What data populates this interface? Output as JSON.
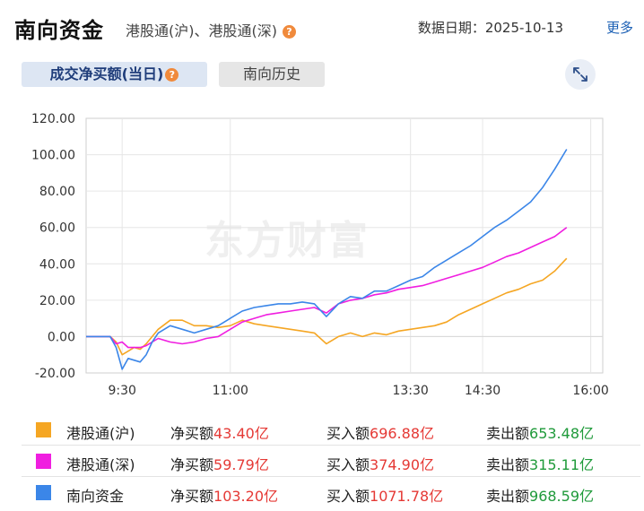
{
  "header": {
    "title": "南向资金",
    "subtitle": "港股通(沪)、港股通(深)",
    "help_icon": "?",
    "date_label": "数据日期：2025-10-13",
    "more_link": "更多"
  },
  "tabs": [
    {
      "label": "成交净买额(当日)",
      "active": true
    },
    {
      "label": "南向历史",
      "active": false
    }
  ],
  "watermark": "东方财富",
  "colors": {
    "hu": "#f5a623",
    "shen": "#f01ee0",
    "total": "#3b86e8"
  },
  "chart_data": {
    "type": "line",
    "title": "",
    "xlabel": "",
    "ylabel": "",
    "ylim": [
      -20,
      120
    ],
    "yticks": [
      "120.00",
      "100.00",
      "80.00",
      "60.00",
      "40.00",
      "20.00",
      "0.00",
      "-20.00"
    ],
    "xticks": [
      "9:30",
      "11:00",
      "13:30",
      "14:30",
      "16:00"
    ],
    "x_time_range": [
      "9:00",
      "16:10"
    ],
    "grid": true,
    "legend": "bottom-table",
    "series": [
      {
        "name": "港股通(沪)",
        "color": "#f5a623",
        "x": [
          "9:00",
          "9:20",
          "9:25",
          "9:30",
          "9:35",
          "9:40",
          "9:45",
          "9:50",
          "9:55",
          "10:00",
          "10:10",
          "10:20",
          "10:30",
          "10:40",
          "10:50",
          "11:00",
          "11:10",
          "11:20",
          "11:30",
          "11:40",
          "11:50",
          "12:00",
          "12:10",
          "12:20",
          "12:30",
          "12:40",
          "12:50",
          "13:00",
          "13:10",
          "13:20",
          "13:30",
          "13:40",
          "13:50",
          "14:00",
          "14:10",
          "14:20",
          "14:30",
          "14:40",
          "14:50",
          "15:00",
          "15:10",
          "15:20",
          "15:30",
          "15:40"
        ],
        "values": [
          0,
          0,
          -3,
          -10,
          -8,
          -6,
          -7,
          -4,
          0,
          4,
          9,
          9,
          6,
          6,
          5,
          6,
          9,
          7,
          6,
          5,
          4,
          3,
          2,
          -4,
          0,
          2,
          0,
          2,
          1,
          3,
          4,
          5,
          6,
          8,
          12,
          15,
          18,
          21,
          24,
          26,
          29,
          31,
          36,
          43
        ]
      },
      {
        "name": "港股通(深)",
        "color": "#f01ee0",
        "x": [
          "9:00",
          "9:20",
          "9:25",
          "9:30",
          "9:35",
          "9:40",
          "9:45",
          "9:50",
          "9:55",
          "10:00",
          "10:10",
          "10:20",
          "10:30",
          "10:40",
          "10:50",
          "11:00",
          "11:10",
          "11:20",
          "11:30",
          "11:40",
          "11:50",
          "12:00",
          "12:10",
          "12:20",
          "12:30",
          "12:40",
          "12:50",
          "13:00",
          "13:10",
          "13:20",
          "13:30",
          "13:40",
          "13:50",
          "14:00",
          "14:10",
          "14:20",
          "14:30",
          "14:40",
          "14:50",
          "15:00",
          "15:10",
          "15:20",
          "15:30",
          "15:40"
        ],
        "values": [
          0,
          0,
          -4,
          -3,
          -6,
          -6,
          -6,
          -5,
          -3,
          -1,
          -3,
          -4,
          -3,
          -1,
          0,
          4,
          8,
          10,
          12,
          13,
          14,
          15,
          16,
          13,
          18,
          20,
          21,
          23,
          24,
          26,
          27,
          28,
          30,
          32,
          34,
          36,
          38,
          41,
          44,
          46,
          49,
          52,
          55,
          60
        ]
      },
      {
        "name": "南向资金",
        "color": "#3b86e8",
        "x": [
          "9:00",
          "9:20",
          "9:25",
          "9:30",
          "9:35",
          "9:40",
          "9:45",
          "9:50",
          "9:55",
          "10:00",
          "10:10",
          "10:20",
          "10:30",
          "10:40",
          "10:50",
          "11:00",
          "11:10",
          "11:20",
          "11:30",
          "11:40",
          "11:50",
          "12:00",
          "12:10",
          "12:20",
          "12:30",
          "12:40",
          "12:50",
          "13:00",
          "13:10",
          "13:20",
          "13:30",
          "13:40",
          "13:50",
          "14:00",
          "14:10",
          "14:20",
          "14:30",
          "14:40",
          "14:50",
          "15:00",
          "15:10",
          "15:20",
          "15:30",
          "15:40"
        ],
        "values": [
          0,
          0,
          -6,
          -18,
          -12,
          -13,
          -14,
          -10,
          -3,
          2,
          6,
          4,
          2,
          4,
          6,
          10,
          14,
          16,
          17,
          18,
          18,
          19,
          18,
          11,
          18,
          22,
          21,
          25,
          25,
          28,
          31,
          33,
          38,
          42,
          46,
          50,
          55,
          60,
          64,
          69,
          74,
          82,
          92,
          103
        ]
      }
    ]
  },
  "legend": [
    {
      "swatch_color": "#f5a623",
      "name": "港股通(沪)",
      "net_label": "净买额",
      "net_value": "43.40亿",
      "buy_label": "买入额",
      "buy_value": "696.88亿",
      "sell_label": "卖出额",
      "sell_value": "653.48亿"
    },
    {
      "swatch_color": "#f01ee0",
      "name": "港股通(深)",
      "net_label": "净买额",
      "net_value": "59.79亿",
      "buy_label": "买入额",
      "buy_value": "374.90亿",
      "sell_label": "卖出额",
      "sell_value": "315.11亿"
    },
    {
      "swatch_color": "#3b86e8",
      "name": "南向资金",
      "net_label": "净买额",
      "net_value": "103.20亿",
      "buy_label": "买入额",
      "buy_value": "1071.78亿",
      "sell_label": "卖出额",
      "sell_value": "968.59亿"
    }
  ]
}
